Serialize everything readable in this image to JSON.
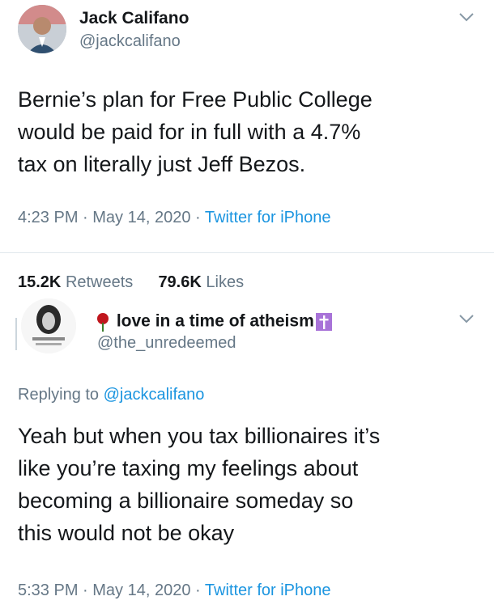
{
  "tweet1": {
    "display_name": "Jack Califano",
    "handle": "@jackcalifano",
    "text": "Bernie’s plan for Free Public College\nwould be paid for in full with a 4.7%\ntax on literally just Jeff Bezos.",
    "time": "4:23 PM",
    "date": "May 14, 2020",
    "source": "Twitter for iPhone",
    "retweets_count": "15.2K",
    "retweets_label": "Retweets",
    "likes_count": "79.6K",
    "likes_label": "Likes"
  },
  "tweet2": {
    "display_name": "love in a time of atheism",
    "handle": "@the_unredeemed",
    "replying_prefix": "Replying to",
    "replying_handle": "@jackcalifano",
    "text": "Yeah but when you tax billionaires it’s\nlike you’re taxing my feelings about\nbecoming a billionaire someday so\nthis would not be okay",
    "time": "5:33 PM",
    "date": "May 14, 2020",
    "source": "Twitter for iPhone"
  },
  "separator": " · ",
  "icons": {
    "chevron": "chevron-down-icon",
    "rose": "rose-emoji-icon",
    "cross": "latin-cross-icon"
  },
  "colors": {
    "link": "#1b95e0",
    "secondary_text": "#657786",
    "primary_text": "#14171a",
    "cross_badge": "#a873d8"
  }
}
